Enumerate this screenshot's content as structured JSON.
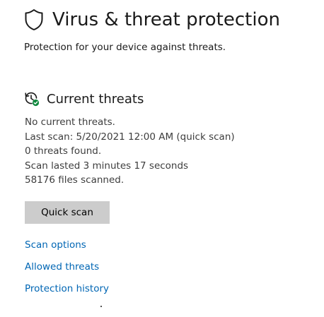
{
  "header": {
    "title": "Virus & threat protection",
    "subtitle": "Protection for your device against threats.",
    "icon": "shield-icon"
  },
  "current_threats": {
    "title": "Current threats",
    "icon": "clock-refresh-check-icon",
    "lines": [
      "No current threats.",
      "Last scan: 5/20/2021 12:00 AM (quick scan)",
      "0 threats found.",
      "Scan lasted 3 minutes 17 seconds",
      "58176 files scanned."
    ],
    "quick_scan_label": "Quick scan"
  },
  "links": {
    "scan_options": "Scan options",
    "allowed_threats": "Allowed threats",
    "protection_history": "Protection history"
  },
  "colors": {
    "link": "#0066b4",
    "button_bg": "#cccccc",
    "status_ok": "#10893e"
  }
}
